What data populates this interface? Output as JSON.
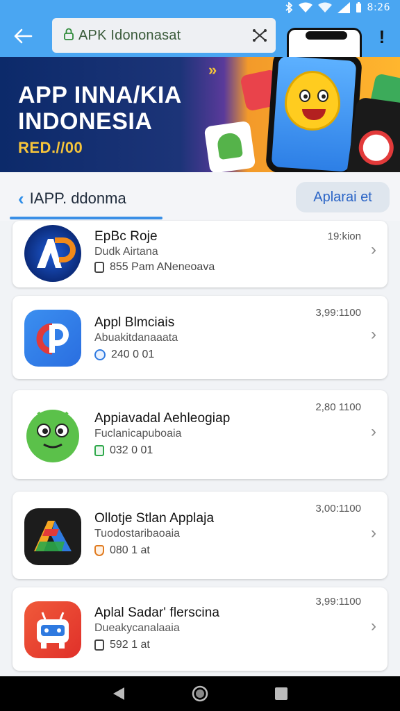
{
  "status_bar": {
    "time": "8:26"
  },
  "address_bar": {
    "url": "APK Idononasat"
  },
  "banner": {
    "title_line1": "APP INNA/KIA",
    "title_line2": "INDONESIA",
    "subtitle": "RED.//00"
  },
  "tabs": {
    "active_label": "IAPP. ddonma",
    "secondary_label": "Aplarai et"
  },
  "apps": [
    {
      "name": "EpBc Roje",
      "developer": "Dudk Airtana",
      "meta": "855 Pam ANeneoava",
      "size": "19:kion",
      "icon": "ap-logo-icon",
      "meta_icon": "doc-icon"
    },
    {
      "name": "Appl Blmciais",
      "developer": "Abuakitdanaaata",
      "meta": "240 0 01",
      "size": "3,99:1100",
      "icon": "cp-logo-icon",
      "meta_icon": "shield-icon"
    },
    {
      "name": "Appiavadal Aehleogiap",
      "developer": "Fuclanicapuboaia",
      "meta": "032 0 01",
      "size": "2,80 1100",
      "icon": "green-face-icon",
      "meta_icon": "storage-icon"
    },
    {
      "name": "Ollotje Stlan Applaja",
      "developer": "Tuodostaribaoaia",
      "meta": "080 1 at",
      "size": "3,00:1100",
      "icon": "colorful-a-icon",
      "meta_icon": "badge-icon"
    },
    {
      "name": "Aplal Sadar' flerscina",
      "developer": "Dueakycanalaaia",
      "meta": "592 1 at",
      "size": "3,99:1100",
      "icon": "robot-icon",
      "meta_icon": "doc-icon"
    }
  ],
  "colors": {
    "top_bar": "#4aa6f2",
    "accent": "#3a8fe6",
    "banner_yellow": "#f6c43a"
  }
}
